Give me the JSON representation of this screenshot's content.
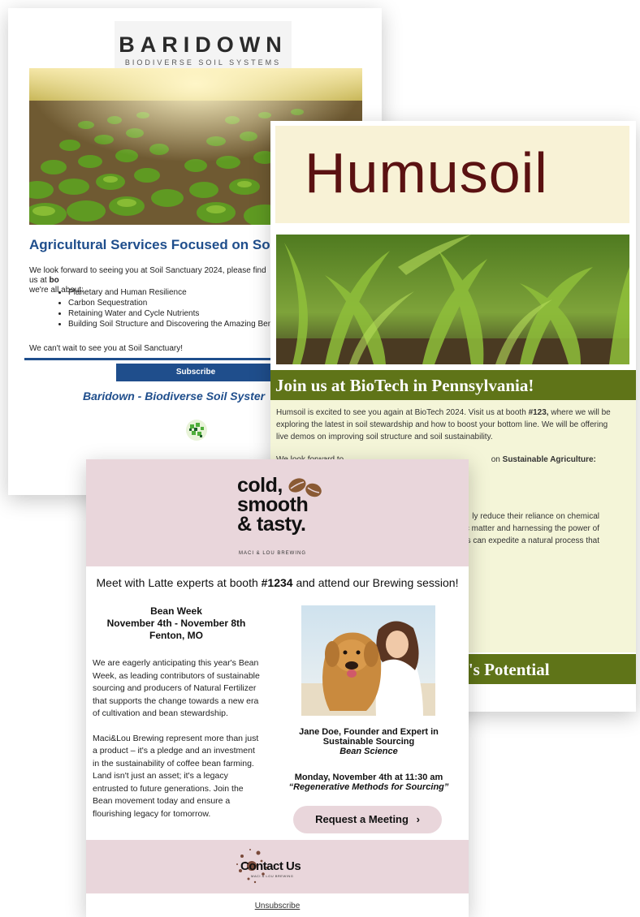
{
  "baridown": {
    "logo_name": "BARIDOWN",
    "logo_tagline": "BIODIVERSE SOIL SYSTEMS",
    "headline": "Agricultural Services Focused on Soil Ma",
    "intro_start": "We look forward to seeing you at Soil Sanctuary 2024, please find us at ",
    "intro_bold": "bo",
    "intro_end": "we're all about:",
    "bullets": [
      "Planetary and Human Resilience",
      "Carbon Sequestration",
      "Retaining Water and Cycle Nutrients",
      "Building Soil Structure and Discovering the Amazing Benefits of"
    ],
    "closing": "We can't wait to see you at Soil Sanctuary!",
    "subscribe_label": "Subscribe",
    "signature": "Baridown - Biodiverse Soil Syster",
    "colors": {
      "accent": "#1f4e8c"
    }
  },
  "humusoil": {
    "logo_text": "Humusoil",
    "band_title": "Join us at BioTech in Pennsylvania!",
    "p1_start": "Humsoil is excited to see you again at BioTech 2024. Visit us at booth ",
    "p1_bold": "#123,",
    "p1_end": " where we will be exploring the latest in soil stewardship and how to boost your bottom line. We will be offering live demos on improving soil structure and soil sustainability.",
    "p2_start": "We look forward to ",
    "p2_end": " on ",
    "p2_bold": "Sustainable Agriculture:",
    "p3_lines": [
      "ly reduce their reliance on chemical",
      "c matter and harnessing the power of",
      "ers can expedite a natural process that"
    ],
    "band2_title": "l's Potential",
    "colors": {
      "band": "#5f7418",
      "logo_bg": "#f8f2d6",
      "logo_text": "#5b1212",
      "body_bg": "#f4f5d8"
    }
  },
  "maci": {
    "brand_line1": "cold,",
    "brand_line2": "smooth",
    "brand_line3": "& tasty.",
    "brand_sub": "MACI & LOU BREWING",
    "lead_start": "Meet with Latte experts at booth ",
    "lead_bold": "#1234",
    "lead_end": " and attend our Brewing session!",
    "event_name": "Bean Week",
    "event_dates": "November 4th - November 8th",
    "event_place": "Fenton, MO",
    "copy_p1": "We are eagerly anticipating this year's Bean Week, as leading contributors of sustainable sourcing and producers of Natural Fertilizer that supports the change towards a new era of cultivation and bean stewardship.",
    "copy_p2": "Maci&Lou Brewing represent more than just a product – it's a pledge and an investment in the sustainability of coffee bean farming. Land isn't just an asset; it's a legacy entrusted to future generations. Join the Bean movement today and ensure a flourishing legacy for tomorrow.",
    "speaker_name": "Jane Doe, Founder and Expert in Sustainable Sourcing",
    "speaker_org": "Bean Science",
    "session_time": "Monday, November 4th at 11:30 am",
    "session_title": "“Regenerative Methods for Sourcing”",
    "meeting_label": "Request a Meeting",
    "meeting_chevron": "›",
    "contact_label": "Contact Us",
    "contact_sub": "MACI & LOU BREWING",
    "unsubscribe_label": "Unsubscribe",
    "colors": {
      "pink": "#e9d6db"
    }
  }
}
